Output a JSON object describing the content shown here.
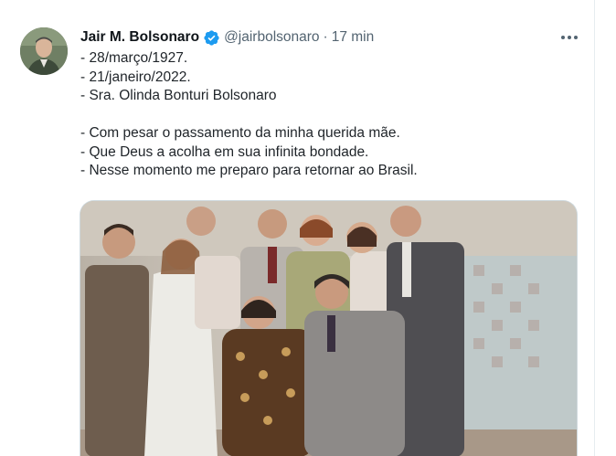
{
  "tweet": {
    "author": {
      "display_name": "Jair M. Bolsonaro",
      "handle": "@jairbolsonaro",
      "verified": true
    },
    "separator": "·",
    "timestamp": "17 min",
    "lines": [
      "- 28/março/1927.",
      "- 21/janeiro/2022.",
      "- Sra. Olinda Bonturi Bolsonaro",
      "",
      "- Com pesar o passamento da minha querida mãe.",
      "- Que Deus a acolha em sua infinita bondade.",
      "- Nesse momento me preparo para retornar ao Brasil."
    ]
  },
  "colors": {
    "verified_blue": "#1d9bf0",
    "secondary_text": "#536471"
  },
  "icons": {
    "verified": "verified-badge-icon",
    "more": "more-options-icon"
  }
}
